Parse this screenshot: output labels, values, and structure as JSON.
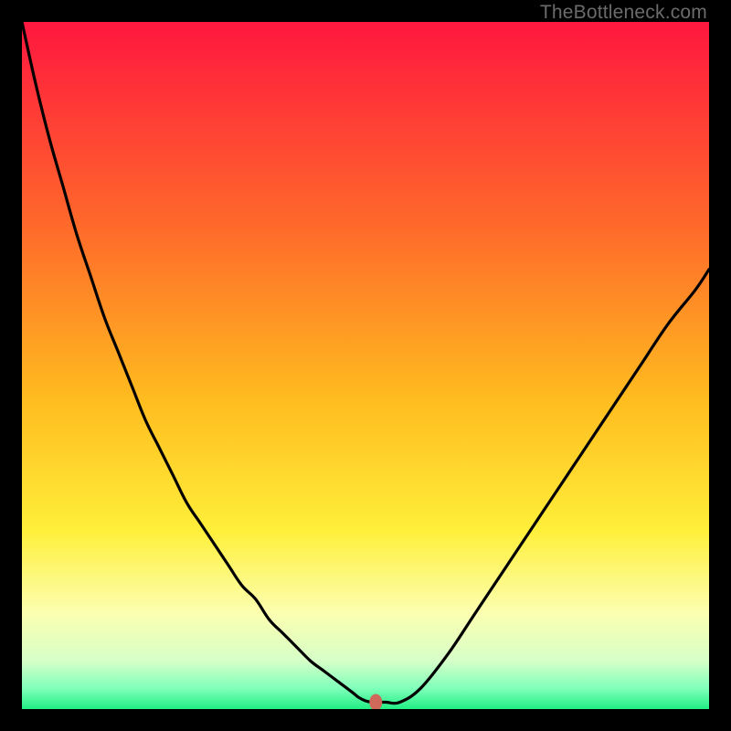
{
  "watermark": "TheBottleneck.com",
  "chart_data": {
    "type": "line",
    "title": "",
    "xlabel": "",
    "ylabel": "",
    "xlim": [
      0,
      100
    ],
    "ylim": [
      0,
      100
    ],
    "x": [
      0,
      2,
      4,
      6,
      8,
      10,
      12,
      14,
      16,
      18,
      20,
      22,
      24,
      26,
      28,
      30,
      32,
      34,
      36,
      38,
      40,
      42,
      44,
      46,
      48,
      49,
      50,
      51,
      52,
      53,
      55,
      58,
      62,
      66,
      70,
      74,
      78,
      82,
      86,
      90,
      94,
      98,
      100
    ],
    "values": [
      100,
      91,
      83,
      76,
      69,
      63,
      57,
      52,
      47,
      42,
      38,
      34,
      30,
      27,
      24,
      21,
      18,
      16,
      13,
      11,
      9,
      7,
      5.5,
      4,
      2.5,
      1.7,
      1.2,
      1.0,
      1.0,
      1.0,
      1.0,
      3,
      8,
      14,
      20,
      26,
      32,
      38,
      44,
      50,
      56,
      61,
      64
    ],
    "marker": {
      "x": 51.5,
      "y": 1.0
    },
    "gradient_stops": [
      {
        "offset": 0,
        "color": "#ff173f"
      },
      {
        "offset": 30,
        "color": "#ff6a2a"
      },
      {
        "offset": 55,
        "color": "#ffbc1f"
      },
      {
        "offset": 74,
        "color": "#ffef3a"
      },
      {
        "offset": 86,
        "color": "#fcffb0"
      },
      {
        "offset": 93,
        "color": "#d6ffc8"
      },
      {
        "offset": 97,
        "color": "#7fffba"
      },
      {
        "offset": 100,
        "color": "#21ef84"
      }
    ]
  }
}
